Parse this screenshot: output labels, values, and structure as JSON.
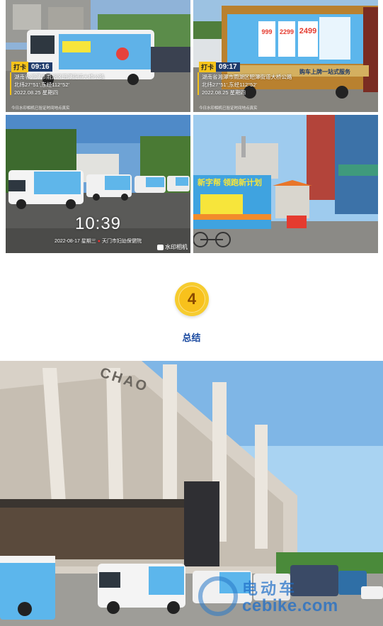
{
  "photos": {
    "p1": {
      "tag_label": "打卡",
      "time": "09:16",
      "location": "湖南省湘潭市雨湖区昭潭街道大桥公路",
      "coords": "北纬27°51',东经112°52'",
      "date": "2022.08.25 星期四",
      "note": "今日水印相机已验证时间地点真实"
    },
    "p2": {
      "tag_label": "打卡",
      "time": "09:17",
      "location": "湖南省湘潭市雨湖区昭潭街道大桥公路",
      "coords": "北纬27°51',东经112°52'",
      "date": "2022.08.25 星期四",
      "note": "今日水印相机已验证时间地点真实",
      "banner_prices": [
        "999",
        "2299",
        "2499"
      ],
      "banner_slogan": "购车上牌一站式服务"
    },
    "p3": {
      "clock": "10:39",
      "date": "2022-08-17 星期三",
      "place": "天门市妇幼保健院",
      "app_label": "水印相机"
    },
    "p4": {
      "banner_text": "新字帮 领跑新计划"
    },
    "p5": {
      "stadium_sign": "CHAO"
    }
  },
  "section": {
    "number": "4",
    "title": "总结"
  },
  "watermark": {
    "cn": "电动车",
    "en": "cebike.com"
  },
  "colors": {
    "badge_yellow": "#f8c11c",
    "title_blue": "#1b4aa0",
    "banner_blue": "#3fa3e0"
  }
}
